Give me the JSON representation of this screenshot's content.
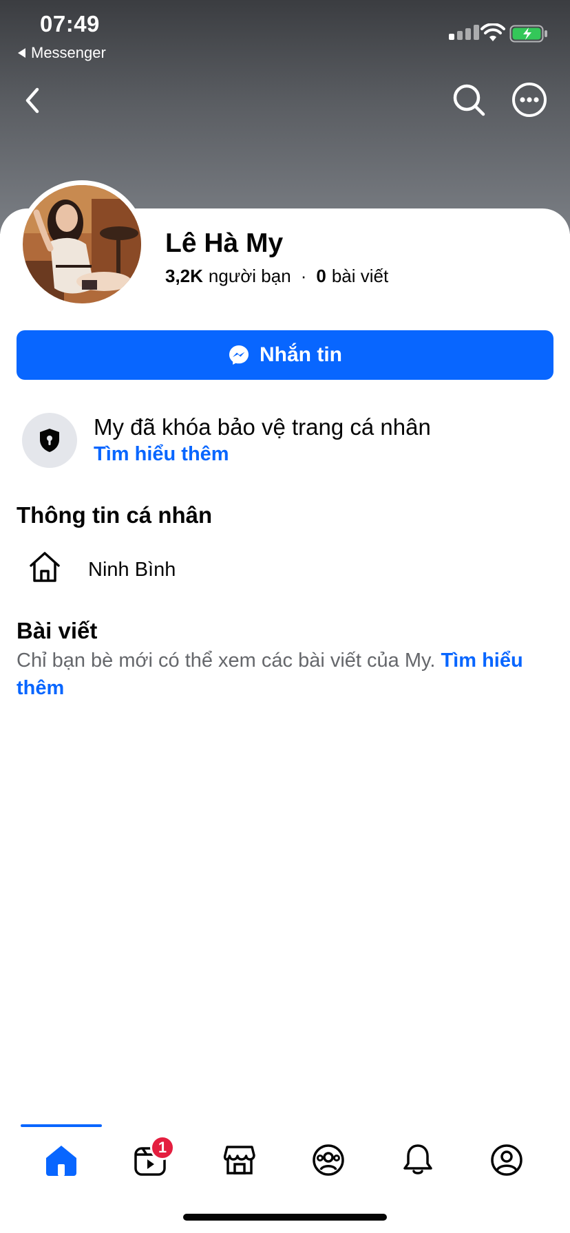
{
  "status_bar": {
    "time": "07:49",
    "back_app": "Messenger"
  },
  "profile": {
    "name": "Lê Hà My",
    "friends_count": "3,2K",
    "friends_label": "người bạn",
    "separator": "·",
    "posts_count": "0",
    "posts_label": "bài viết"
  },
  "message_button": {
    "label": "Nhắn tin",
    "color": "#0866ff"
  },
  "lock_notice": {
    "title": "My đã khóa bảo vệ trang cá nhân",
    "link": "Tìm hiểu thêm"
  },
  "personal_info": {
    "title": "Thông tin cá nhân",
    "hometown": "Ninh Bình"
  },
  "posts_section": {
    "title": "Bài viết",
    "description": "Chỉ bạn bè mới có thể xem các bài viết của My.",
    "link": "Tìm hiểu thêm"
  },
  "tabbar": {
    "items": [
      {
        "name": "home",
        "icon": "home-icon",
        "active": true
      },
      {
        "name": "video",
        "icon": "video-icon",
        "badge": "1"
      },
      {
        "name": "marketplace",
        "icon": "marketplace-icon"
      },
      {
        "name": "groups",
        "icon": "groups-icon"
      },
      {
        "name": "notifications",
        "icon": "bell-icon"
      },
      {
        "name": "profile",
        "icon": "profile-icon"
      }
    ]
  },
  "colors": {
    "accent": "#0866ff",
    "badge": "#e41e3f",
    "secondary_text": "#65676b",
    "battery": "#34c759"
  }
}
